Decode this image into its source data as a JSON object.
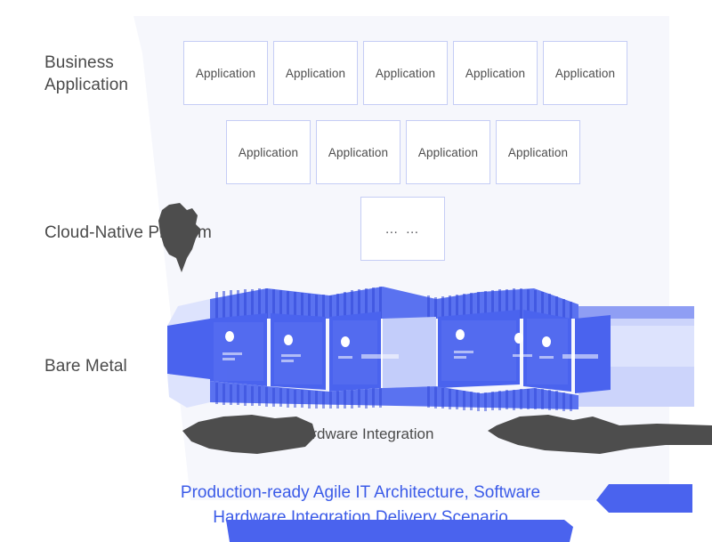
{
  "diagram": {
    "title_caption": {
      "line1": "Production-ready Agile IT Architecture, Software",
      "line2": "Hardware Integration Delivery Scenario",
      "color": "#3b5be8"
    },
    "mid_caption": "& Hardware Integration",
    "tiers": [
      {
        "id": "business-application",
        "label": "Business\nApplication"
      },
      {
        "id": "cloud-native-platform",
        "label": "Cloud-Native Platform"
      },
      {
        "id": "bare-metal",
        "label": "Bare Metal"
      }
    ],
    "app_rows": [
      {
        "row": 1,
        "boxes": [
          {
            "label": "Application"
          },
          {
            "label": "Application"
          },
          {
            "label": "Application"
          },
          {
            "label": "Application"
          },
          {
            "label": "Application"
          }
        ]
      },
      {
        "row": 2,
        "boxes": [
          {
            "label": "Application"
          },
          {
            "label": "Application"
          },
          {
            "label": "Application"
          },
          {
            "label": "Application"
          }
        ]
      },
      {
        "row": 3,
        "boxes": [
          {
            "label": "… …"
          }
        ]
      }
    ],
    "illustration": {
      "name": "server-rack-illustration",
      "unit_count": 6,
      "primary_color": "#4a63ee",
      "mid_color": "#7b8cf2",
      "light_color": "#ccd4fb",
      "pale_color": "#e3e8fd"
    },
    "colors": {
      "panel_background": "#f6f7fc",
      "box_border": "#c5cdf5",
      "box_fill": "#ffffff",
      "label_text": "#4a4a4a",
      "accent_blue": "#4a63ee",
      "redaction_dark": "#4d4d4d"
    }
  }
}
